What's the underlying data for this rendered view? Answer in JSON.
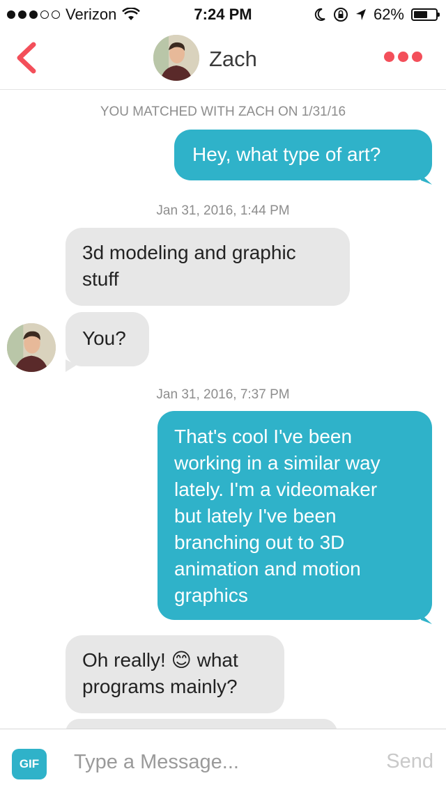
{
  "status_bar": {
    "carrier": "Verizon",
    "time": "7:24 PM",
    "battery_percent_label": "62%",
    "battery_level": 0.62,
    "signal_bars_filled": 3,
    "signal_bars_total": 5
  },
  "header": {
    "contact_name": "Zach"
  },
  "colors": {
    "accent_red": "#f34f5a",
    "sent_bubble": "#2fb2c9",
    "received_bubble": "#e7e7e7"
  },
  "conversation": {
    "match_notice": "YOU MATCHED WITH ZACH ON 1/31/16",
    "timestamps": [
      "Jan 31, 2016, 1:44 PM",
      "Jan 31, 2016, 7:37 PM"
    ],
    "messages": [
      {
        "direction": "sent",
        "text": "Hey, what type of art?"
      },
      {
        "direction": "received",
        "lines": [
          "3d modeling and graphic",
          "stuff"
        ]
      },
      {
        "direction": "received",
        "text": "You?"
      },
      {
        "direction": "sent",
        "lines": [
          "That's cool I've been",
          "working in a similar way",
          "lately. I'm a videomaker",
          "but lately I've been",
          "branching out to 3D",
          "animation and motion",
          "graphics"
        ]
      },
      {
        "direction": "received",
        "lines": [
          "Oh really!",
          "what",
          "programs mainly?"
        ],
        "emoji": "😊"
      }
    ]
  },
  "composer": {
    "gif_label": "GIF",
    "placeholder": "Type a Message...",
    "send_label": "Send"
  }
}
